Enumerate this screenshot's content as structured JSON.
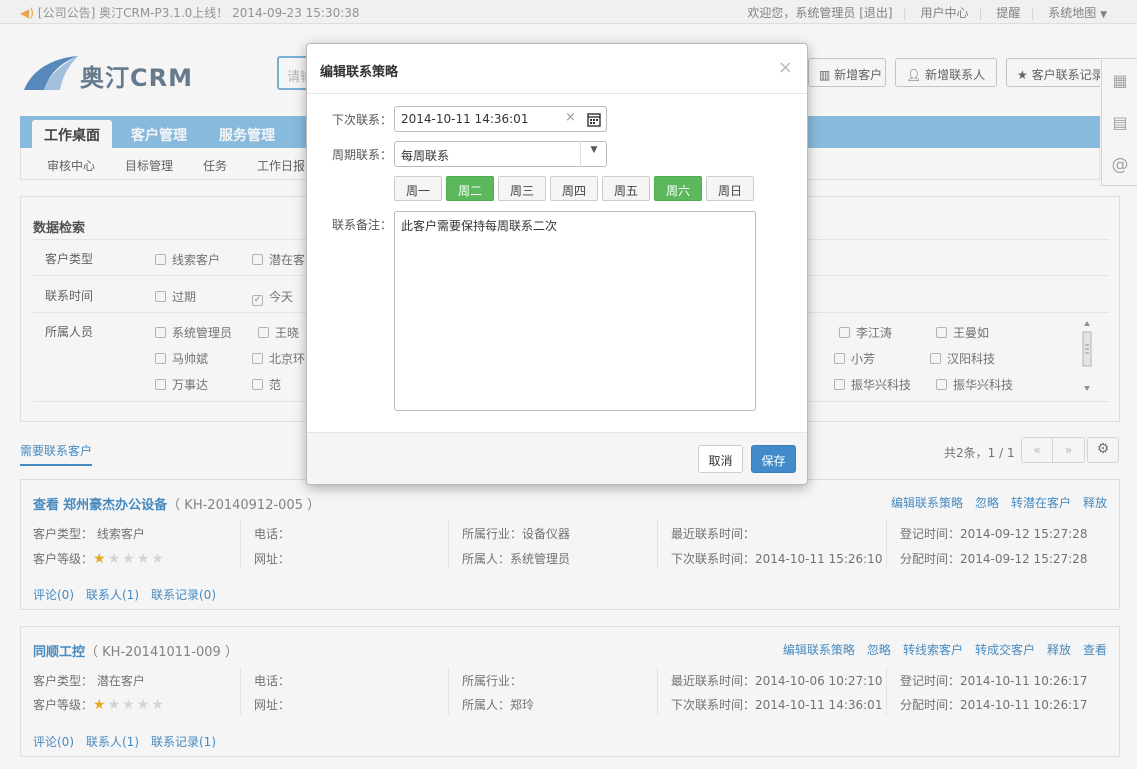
{
  "topbar": {
    "notice": "[公司公告] 奥汀CRM-P3.1.0上线！ 2014-09-23 15:30:38",
    "welcome": "欢迎您，系统管理员 [退出]",
    "user_center": "用户中心",
    "reminder": "提醒",
    "site_map": "系统地图"
  },
  "header": {
    "logo_text": "奥汀CRM",
    "search_placeholder": "请输",
    "buttons": {
      "new_customer": "新增客户",
      "new_contact": "新增联系人",
      "contact_record": "客户联系记录"
    }
  },
  "nav": {
    "tabs": [
      "工作桌面",
      "客户管理",
      "服务管理"
    ],
    "subitems": [
      "审核中心",
      "目标管理",
      "任务",
      "工作日报"
    ]
  },
  "filter": {
    "title": "数据检索",
    "rows": [
      {
        "label": "客户类型",
        "options": [
          "线索客户",
          "潜在客"
        ]
      },
      {
        "label": "联系时间",
        "options": [
          "过期",
          "今天"
        ]
      },
      {
        "label": "所属人员",
        "col1": [
          "系统管理员",
          "马帅斌",
          "万事达"
        ],
        "col2": [
          "王晓",
          "北京环",
          "范"
        ],
        "col3": [
          "李江涛",
          "小芳",
          "振华兴科技"
        ],
        "col4": [
          "王曼如",
          "汉阳科技",
          "振华兴科技"
        ]
      }
    ]
  },
  "list": {
    "title": "需要联系客户",
    "page_info": "共2条，1 / 1",
    "prev": "«",
    "next": "»"
  },
  "cards": [
    {
      "view": "查看",
      "name": "郑州豪杰办公设备",
      "code": "（ KH-20140912-005 ）",
      "actions": [
        "编辑联系策略",
        "忽略",
        "转潜在客户",
        "释放"
      ],
      "type": "客户类型：  线索客户",
      "level_label": "客户等级：",
      "stars": 1,
      "phone": "电话：",
      "site": "网址：",
      "industry": "所属行业：设备仪器",
      "owner": "所属人：系统管理员",
      "last_contact": "最近联系时间：",
      "next_contact": "下次联系时间：2014-10-11 15:26:10",
      "reg_time": "登记时间：2014-09-12 15:27:28",
      "assign_time": "分配时间：2014-09-12 15:27:28",
      "links": [
        "评论(0)",
        "联系人(1)",
        "联系记录(0)"
      ]
    },
    {
      "view": "",
      "name": "同顺工控",
      "code": "（ KH-20141011-009 ）",
      "actions": [
        "编辑联系策略",
        "忽略",
        "转线索客户",
        "转成交客户",
        "释放",
        "查看"
      ],
      "type": "客户类型：  潜在客户",
      "level_label": "客户等级：",
      "stars": 1,
      "phone": "电话：",
      "site": "网址：",
      "industry": "所属行业：",
      "owner": "所属人：郑玲",
      "last_contact": "最近联系时间：2014-10-06 10:27:10",
      "next_contact": "下次联系时间：2014-10-11 14:36:01",
      "reg_time": "登记时间：2014-10-11 10:26:17",
      "assign_time": "分配时间：2014-10-11 10:26:17",
      "links": [
        "评论(0)",
        "联系人(1)",
        "联系记录(1)"
      ]
    }
  ],
  "modal": {
    "title": "编辑联系策略",
    "close": "×",
    "next_contact_label": "下次联系：",
    "next_contact_value": "2014-10-11 14:36:01",
    "clear": "×",
    "cycle_label": "周期联系：",
    "cycle_value": "每周联系",
    "days": [
      {
        "label": "周一",
        "on": false
      },
      {
        "label": "周二",
        "on": true
      },
      {
        "label": "周三",
        "on": false
      },
      {
        "label": "周四",
        "on": false
      },
      {
        "label": "周五",
        "on": false
      },
      {
        "label": "周六",
        "on": true
      },
      {
        "label": "周日",
        "on": false
      }
    ],
    "remark_label": "联系备注：",
    "remark_value": "此客户需要保持每周联系二次",
    "cancel": "取消",
    "save": "保存"
  },
  "colors": {
    "accent": "#428bca",
    "nav": "#8ec2e6",
    "active_day": "#5cb85c",
    "star": "#f2b01e"
  }
}
